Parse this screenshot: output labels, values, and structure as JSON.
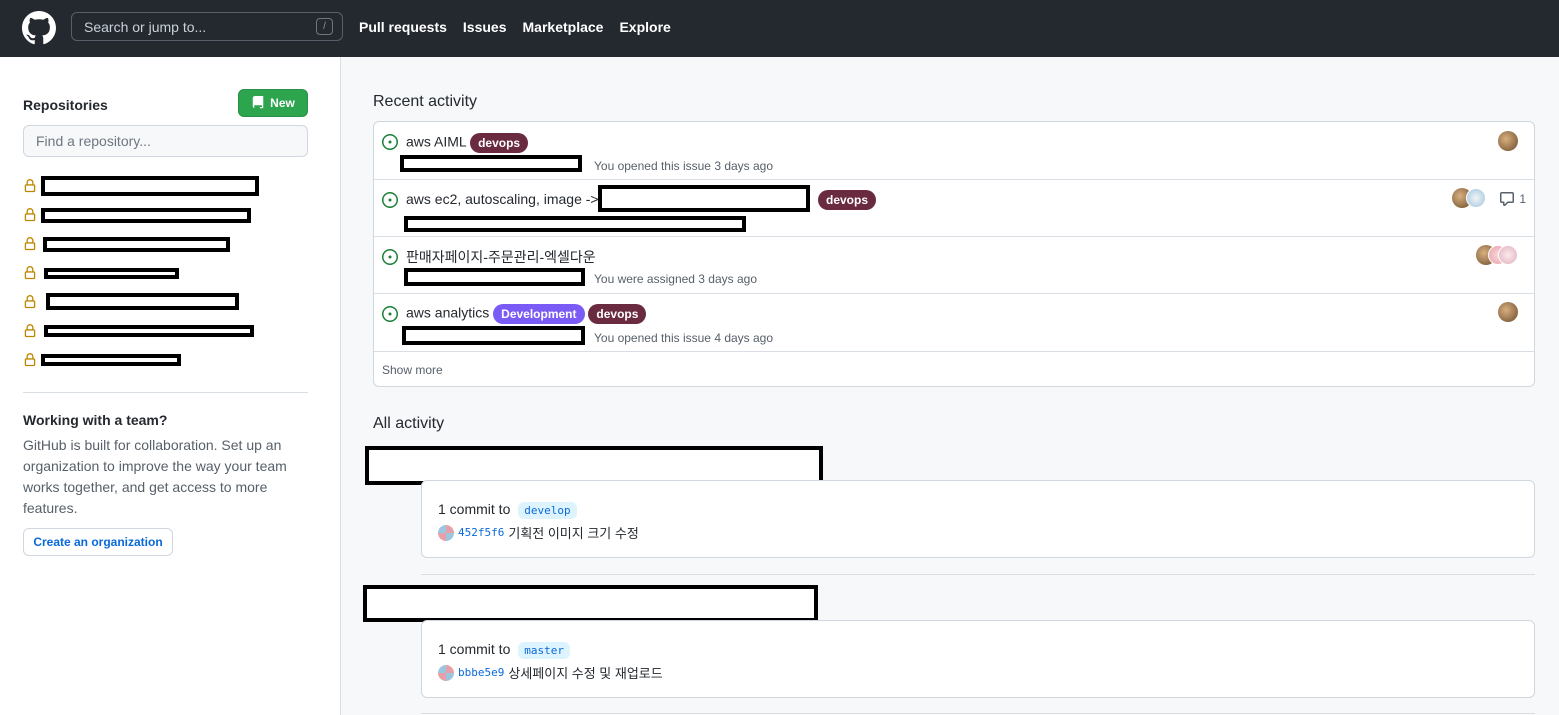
{
  "header": {
    "search_placeholder": "Search or jump to...",
    "search_shortcut": "/",
    "nav": [
      "Pull requests",
      "Issues",
      "Marketplace",
      "Explore"
    ]
  },
  "sidebar": {
    "title": "Repositories",
    "new_label": "New",
    "find_placeholder": "Find a repository...",
    "repo_count": 7,
    "team_title": "Working with a team?",
    "team_text": "GitHub is built for collaboration. Set up an organization to improve the way your team works together, and get access to more features.",
    "create_org_label": "Create an organization"
  },
  "recent": {
    "title": "Recent activity",
    "items": [
      {
        "title": "aws AIML",
        "labels": [
          {
            "text": "devops",
            "color": "#6a2a3f"
          }
        ],
        "meta": "You opened this issue 3 days ago",
        "comments": ""
      },
      {
        "title": "aws ec2, autoscaling, image ->",
        "labels": [
          {
            "text": "devops",
            "color": "#6a2a3f"
          }
        ],
        "meta": "",
        "comments": "1"
      },
      {
        "title": "판매자페이지-주문관리-엑셀다운",
        "labels": [],
        "meta": "You were assigned 3 days ago",
        "comments": ""
      },
      {
        "title": "aws analytics",
        "labels": [
          {
            "text": "Development",
            "color": "#7b5bf5"
          },
          {
            "text": "devops",
            "color": "#6a2a3f"
          }
        ],
        "meta": "You opened this issue 4 days ago",
        "comments": ""
      }
    ],
    "show_more": "Show more"
  },
  "all_activity": {
    "title": "All activity",
    "events": [
      {
        "commit_text": "1 commit to",
        "branch": "develop",
        "sha": "452f5f6",
        "message": "기획전 이미지 크기 수정"
      },
      {
        "commit_text": "1 commit to",
        "branch": "master",
        "sha": "bbbe5e9",
        "message": "상세페이지 수정 및 재업로드"
      }
    ]
  },
  "colors": {
    "header_bg": "#24292f",
    "new_button": "#2da44e",
    "link": "#0969da",
    "issue_open": "#1a7f37",
    "lock": "#bf8700"
  }
}
